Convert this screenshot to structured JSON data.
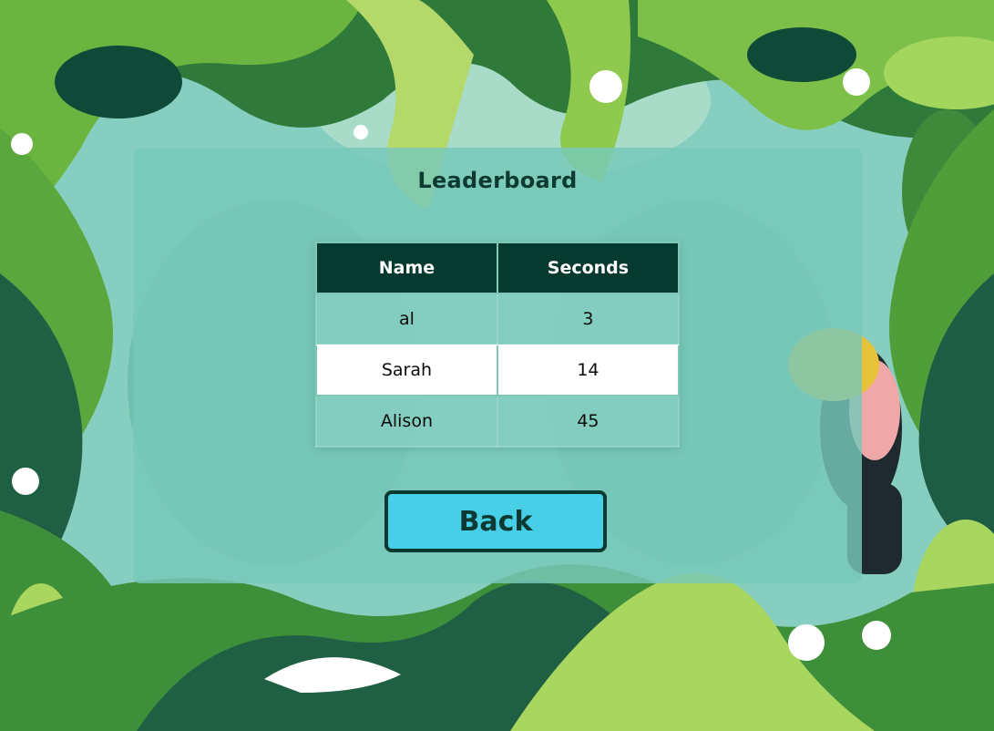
{
  "leaderboard": {
    "title": "Leaderboard",
    "columns": {
      "name": "Name",
      "seconds": "Seconds"
    },
    "rows": [
      {
        "name": "al",
        "seconds": "3"
      },
      {
        "name": "Sarah",
        "seconds": "14"
      },
      {
        "name": "Alison",
        "seconds": "45"
      }
    ]
  },
  "back_label": "Back",
  "colors": {
    "header_bg": "#063a30",
    "button_bg": "#46cfe6",
    "button_border": "#0c3a33",
    "panel": "#78c8ba"
  }
}
